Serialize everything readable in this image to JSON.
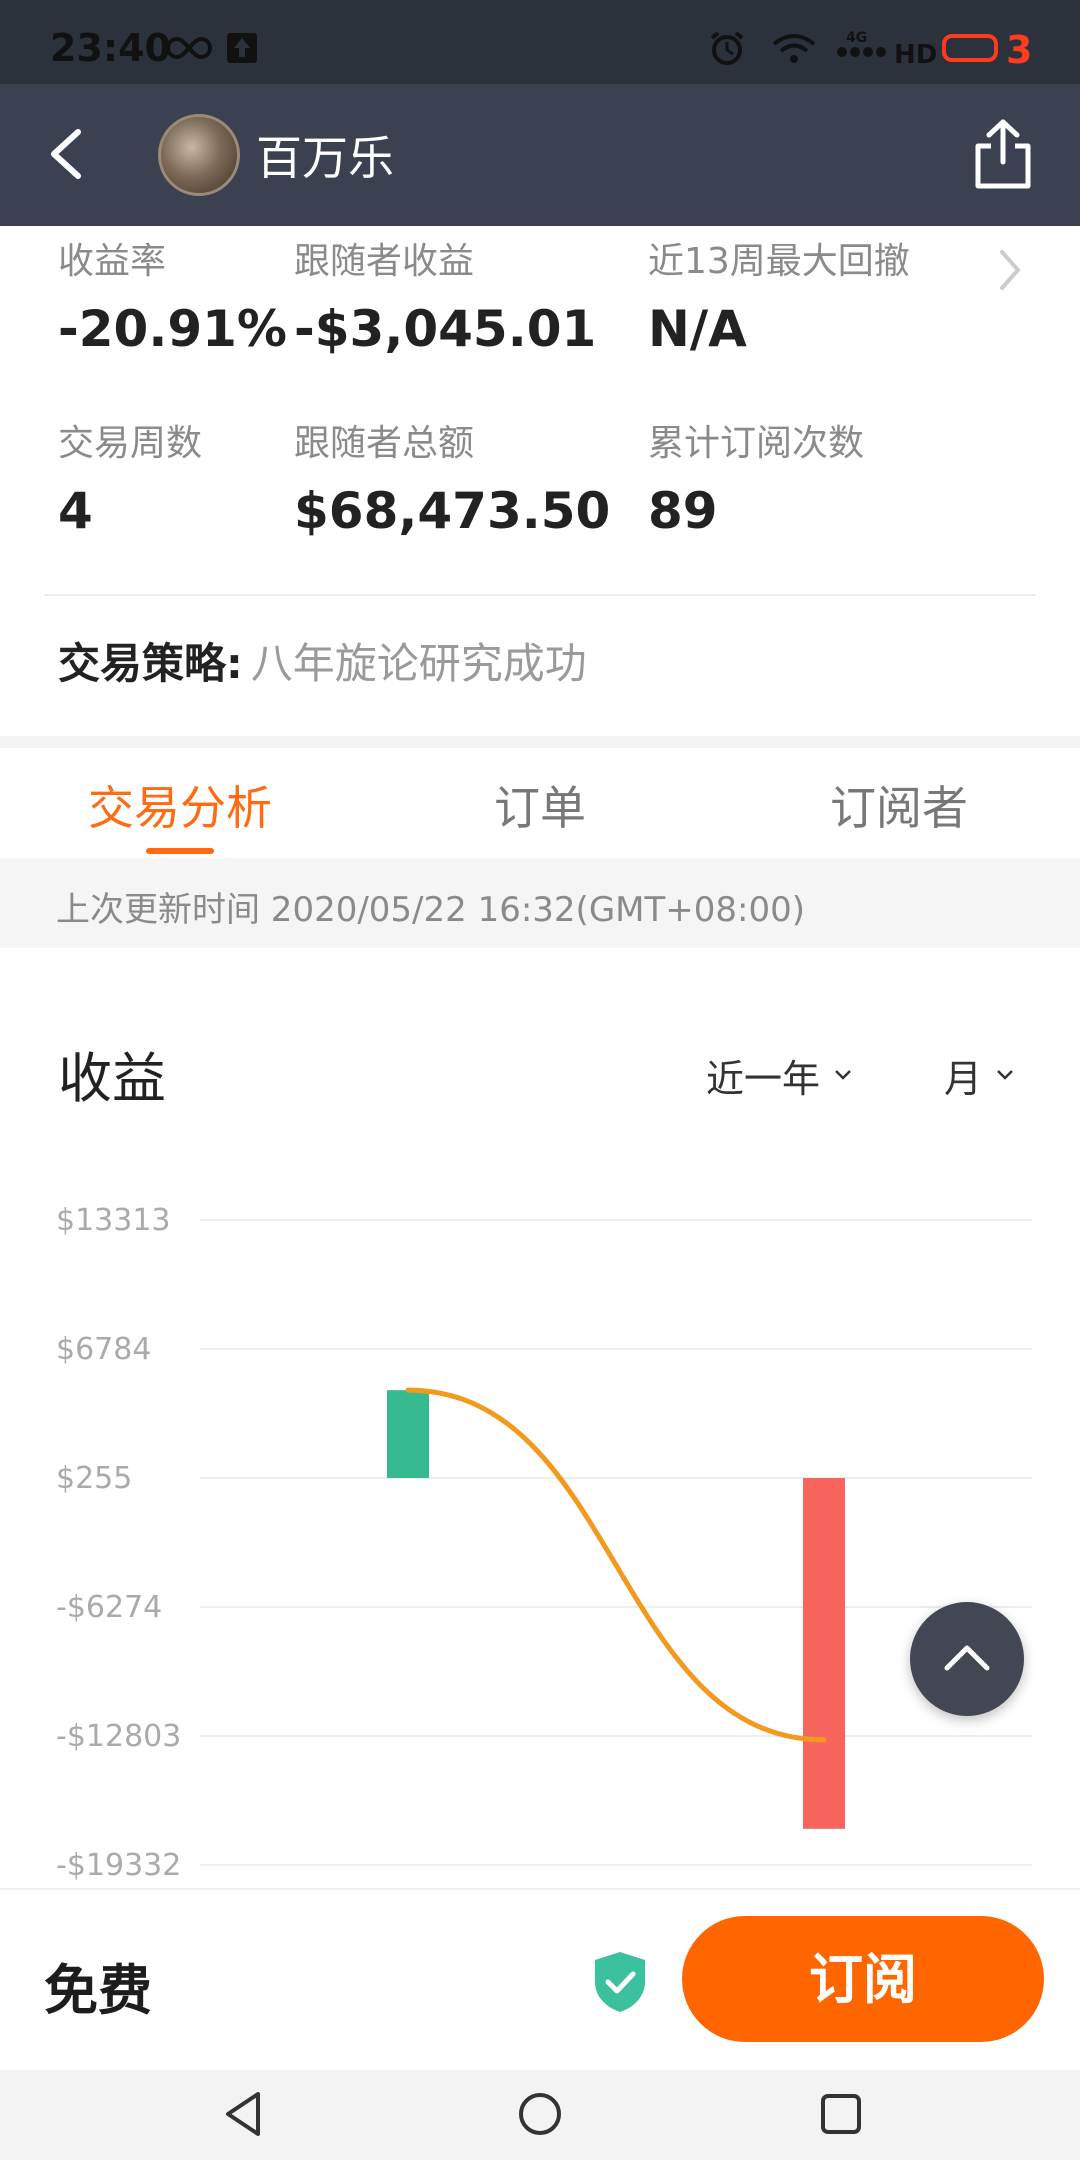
{
  "status_bar": {
    "time": "23:40",
    "network": "4G",
    "hd": "HD",
    "battery_level": "3"
  },
  "app_bar": {
    "title": "百万乐"
  },
  "stats": [
    {
      "label": "收益率",
      "value": "-20.91%"
    },
    {
      "label": "跟随者收益",
      "value": "-$3,045.01"
    },
    {
      "label": "近13周最大回撤",
      "value": "N/A"
    },
    {
      "label": "交易周数",
      "value": "4"
    },
    {
      "label": "跟随者总额",
      "value": "$68,473.50"
    },
    {
      "label": "累计订阅次数",
      "value": "89"
    }
  ],
  "strategy": {
    "label": "交易策略:",
    "value": "八年旋论研究成功"
  },
  "tabs": [
    {
      "label": "交易分析",
      "active": true
    },
    {
      "label": "订单",
      "active": false
    },
    {
      "label": "订阅者",
      "active": false
    }
  ],
  "update_info": "上次更新时间 2020/05/22 16:32(GMT+08:00)",
  "chart_section": {
    "title": "收益",
    "range_select": "近一年",
    "period_select": "月"
  },
  "chart_data": {
    "type": "bar",
    "title": "收益",
    "y_ticks": [
      13313,
      6784,
      255,
      -6274,
      -12803,
      -19332
    ],
    "y_tick_labels": [
      "$13313",
      "$6784",
      "$255",
      "-$6274",
      "-$12803",
      "-$19332"
    ],
    "ylim": [
      -19332,
      13313
    ],
    "grid": true,
    "series": [
      {
        "type": "bar",
        "values": [
          4700,
          -17500
        ],
        "colors": [
          "#35bb8f",
          "#f7645e"
        ]
      },
      {
        "type": "line",
        "values": [
          4700,
          -13000
        ],
        "color": "#f29a1d"
      }
    ],
    "x_positions": [
      0.25,
      0.75
    ]
  },
  "footer": {
    "price": "免费",
    "subscribe_label": "订阅"
  },
  "colors": {
    "accent": "#ff6600",
    "gain": "#35bb8f",
    "loss": "#f7645e",
    "line": "#f29a1d",
    "appbar": "#3b4150"
  }
}
